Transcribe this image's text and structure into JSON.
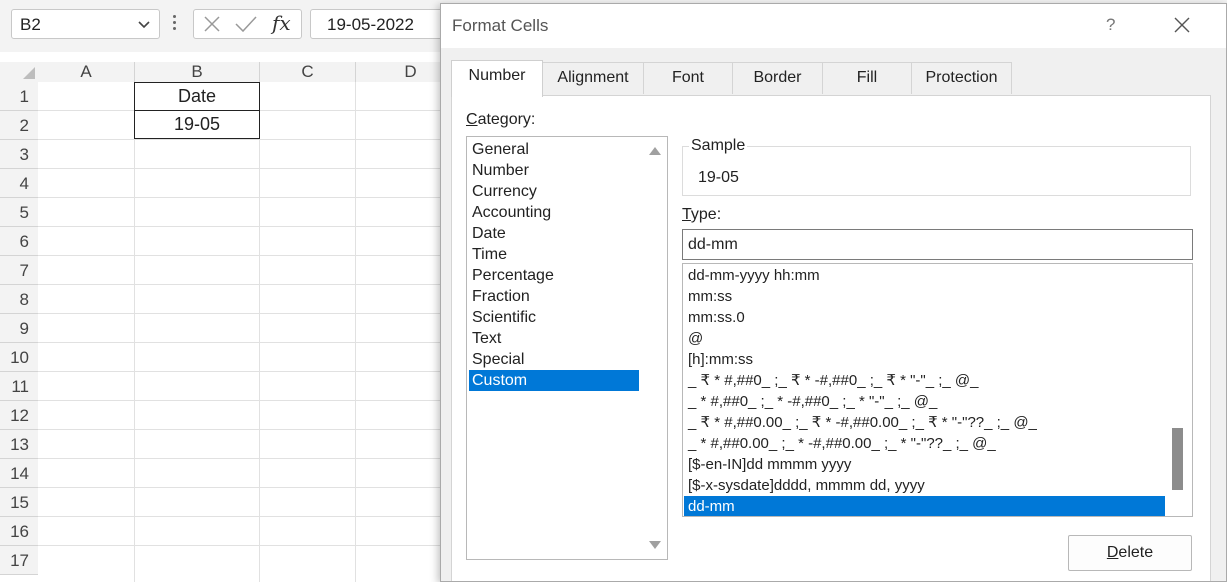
{
  "excel": {
    "name_box": "B2",
    "formula_value": "19-05-2022",
    "fx_label": "fx",
    "columns": [
      "A",
      "B",
      "C",
      "D"
    ],
    "rows": [
      "1",
      "2",
      "3",
      "4",
      "5",
      "6",
      "7",
      "8",
      "9",
      "10",
      "11",
      "12",
      "13",
      "14",
      "15",
      "16",
      "17"
    ],
    "cells": {
      "B1": "Date",
      "B2": "19-05"
    }
  },
  "dialog": {
    "title": "Format Cells",
    "help": "?",
    "tabs": [
      "Number",
      "Alignment",
      "Font",
      "Border",
      "Fill",
      "Protection"
    ],
    "active_tab": "Number",
    "category_label_first": "C",
    "category_label_rest": "ategory:",
    "categories": [
      "General",
      "Number",
      "Currency",
      "Accounting",
      "Date",
      "Time",
      "Percentage",
      "Fraction",
      "Scientific",
      "Text",
      "Special",
      "Custom"
    ],
    "selected_category": "Custom",
    "sample_label": "Sample",
    "sample_value": "19-05",
    "type_label_first": "T",
    "type_label_rest": "ype:",
    "type_input": "dd-mm",
    "type_list": [
      "dd-mm-yyyy hh:mm",
      "mm:ss",
      "mm:ss.0",
      "@",
      "[h]:mm:ss",
      "_ ₹ * #,##0_ ;_ ₹ * -#,##0_ ;_ ₹ * \"-\"_ ;_ @_",
      "_ * #,##0_ ;_ * -#,##0_ ;_ * \"-\"_ ;_ @_",
      "_ ₹ * #,##0.00_ ;_ ₹ * -#,##0.00_ ;_ ₹ * \"-\"??_ ;_ @_",
      "_ * #,##0.00_ ;_ * -#,##0.00_ ;_ * \"-\"??_ ;_ @_",
      "[$-en-IN]dd mmmm yyyy",
      "[$-x-sysdate]dddd, mmmm dd, yyyy",
      "dd-mm"
    ],
    "selected_type": "dd-mm",
    "delete_first": "D",
    "delete_rest": "elete"
  }
}
